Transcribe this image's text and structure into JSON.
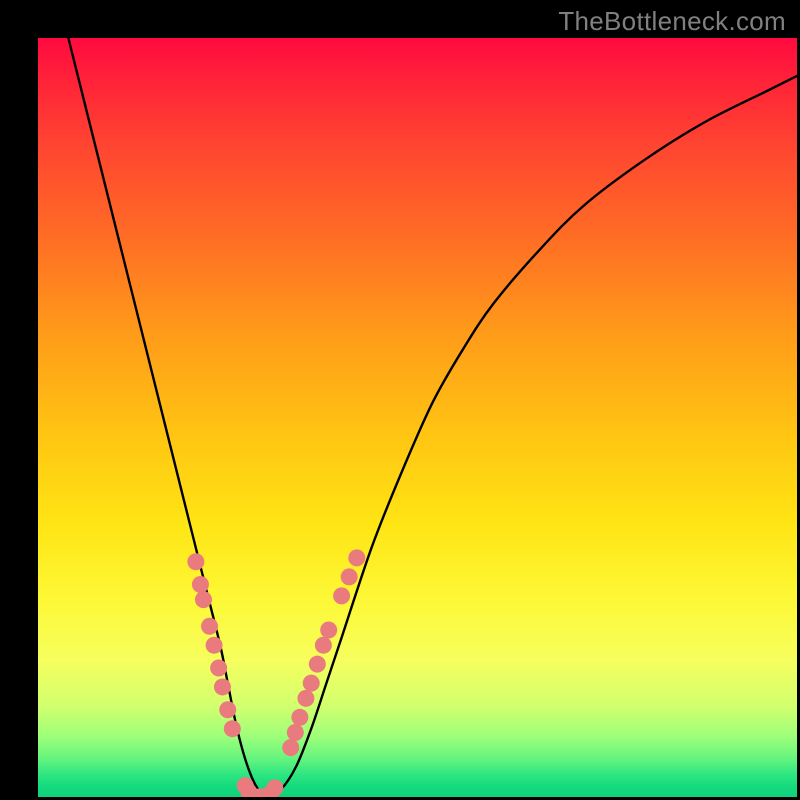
{
  "watermark": "TheBottleneck.com",
  "chart_data": {
    "type": "line",
    "title": "",
    "xlabel": "",
    "ylabel": "",
    "xlim": [
      0,
      100
    ],
    "ylim": [
      0,
      100
    ],
    "series": [
      {
        "name": "bottleneck-curve",
        "x": [
          4,
          6,
          8,
          10,
          12,
          14,
          16,
          18,
          20,
          22,
          24,
          25,
          26,
          27,
          28,
          29,
          30,
          32,
          34,
          36,
          38,
          40,
          44,
          48,
          52,
          56,
          60,
          66,
          72,
          80,
          88,
          96,
          100
        ],
        "y": [
          100,
          92,
          84,
          76,
          68,
          60,
          52,
          44,
          36,
          28,
          20,
          15,
          10,
          6,
          3,
          1,
          0,
          1,
          4,
          9,
          15,
          21,
          33,
          43,
          52,
          59,
          65,
          72,
          78,
          84,
          89,
          93,
          95
        ]
      }
    ],
    "markers": {
      "name": "highlight-dots",
      "points": [
        {
          "x": 20.8,
          "y": 31
        },
        {
          "x": 21.4,
          "y": 28
        },
        {
          "x": 21.8,
          "y": 26
        },
        {
          "x": 22.6,
          "y": 22.5
        },
        {
          "x": 23.2,
          "y": 20
        },
        {
          "x": 23.8,
          "y": 17
        },
        {
          "x": 24.3,
          "y": 14.5
        },
        {
          "x": 25.0,
          "y": 11.5
        },
        {
          "x": 25.6,
          "y": 9
        },
        {
          "x": 27.3,
          "y": 1.5
        },
        {
          "x": 27.8,
          "y": 0.6
        },
        {
          "x": 28.6,
          "y": 0.0
        },
        {
          "x": 29.2,
          "y": 0.0
        },
        {
          "x": 29.8,
          "y": 0.0
        },
        {
          "x": 30.6,
          "y": 0.4
        },
        {
          "x": 31.2,
          "y": 1.2
        },
        {
          "x": 33.3,
          "y": 6.5
        },
        {
          "x": 33.9,
          "y": 8.5
        },
        {
          "x": 34.5,
          "y": 10.5
        },
        {
          "x": 35.3,
          "y": 13
        },
        {
          "x": 36.0,
          "y": 15
        },
        {
          "x": 36.8,
          "y": 17.5
        },
        {
          "x": 37.6,
          "y": 20
        },
        {
          "x": 38.3,
          "y": 22
        },
        {
          "x": 40.0,
          "y": 26.5
        },
        {
          "x": 41.0,
          "y": 29
        },
        {
          "x": 42.0,
          "y": 31.5
        }
      ]
    },
    "background_gradient": {
      "stops": [
        {
          "pos": 0,
          "color": "#ff0a3f"
        },
        {
          "pos": 100,
          "color": "#0fd17b"
        }
      ]
    }
  }
}
